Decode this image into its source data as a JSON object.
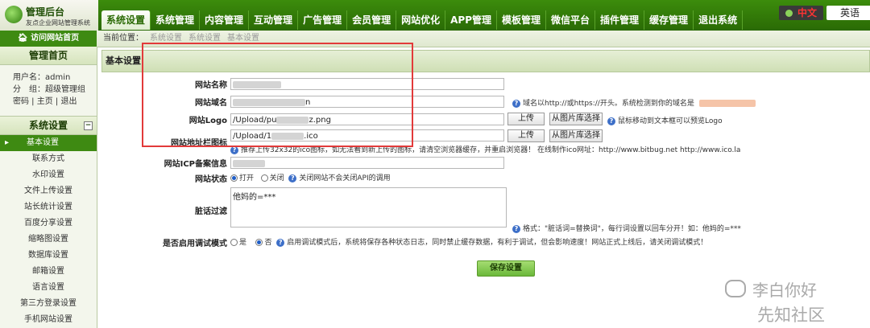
{
  "header": {
    "logo_title": "管理后台",
    "logo_subtitle": "友点企业网站管理系统",
    "nav": [
      "系统设置",
      "系统管理",
      "内容管理",
      "互动管理",
      "广告管理",
      "会员管理",
      "网站优化",
      "APP管理",
      "模板管理",
      "微信平台",
      "插件管理",
      "缓存管理",
      "退出系统"
    ],
    "lang_zh": "中文",
    "lang_en": "英语"
  },
  "subbar": {
    "visit_home": "访问网站首页",
    "breadcrumb_label": "当前位置：",
    "crumbs": [
      "系统设置",
      "系统设置",
      "基本设置"
    ]
  },
  "sidebar": {
    "home_title": "管理首页",
    "user_line": "用户名：admin",
    "group_line": "分　组：超级管理组",
    "links": [
      "密码",
      "主页",
      "退出"
    ],
    "section_title": "系统设置",
    "items": [
      "基本设置",
      "联系方式",
      "水印设置",
      "文件上传设置",
      "站长统计设置",
      "百度分享设置",
      "缩略图设置",
      "数据库设置",
      "邮箱设置",
      "语言设置",
      "第三方登录设置",
      "手机网站设置"
    ]
  },
  "main": {
    "panel_title": "基本设置",
    "fields": {
      "site_name_label": "网站名称",
      "site_domain_label": "网站域名",
      "site_domain_value_tail": "n",
      "site_domain_hint": "域名以http://或https://开头。系统检测到你的域名是",
      "site_logo_label": "网站Logo",
      "site_logo_value": "/Upload/pu",
      "site_logo_value_tail": "z.png",
      "logo_hint": "鼠标移动到文本框可以预览Logo",
      "favicon_label": "网站地址栏图标",
      "favicon_value": "/Upload/1",
      "favicon_value_tail": ".ico",
      "favicon_hint": "推荐上传32x32的ico图标，如无法看到新上传的图标，请清空浏览器缓存，并重启浏览器！ 在线制作ico网址：http://www.bitbug.net     http://www.ico.la",
      "icp_label": "网站ICP备案信息",
      "status_label": "网站状态",
      "status_open": "打开",
      "status_close": "关闭",
      "status_hint": "关闭网站不会关闭API的调用",
      "filter_label": "脏话过滤",
      "filter_value": "他妈的=***",
      "filter_hint": "格式：\"脏话词=替换词\"，每行词设置以回车分开！如：他妈的=***",
      "debug_label": "是否启用调试模式",
      "debug_yes": "是",
      "debug_no": "否",
      "debug_hint": "启用调试模式后，系统将保存各种状态日志，同时禁止缓存数据，有利于调试，但会影响速度！网站正式上线后，请关闭调试模式！"
    },
    "buttons": {
      "upload": "上传",
      "from_library": "从图片库选择",
      "save": "保存设置"
    }
  },
  "watermark": {
    "line1": "李白你好",
    "line2": "先知社区"
  },
  "colors": {
    "header_green": "#2a6a05",
    "highlight_red": "#e23a3a",
    "help_blue": "#3d6fc8"
  }
}
